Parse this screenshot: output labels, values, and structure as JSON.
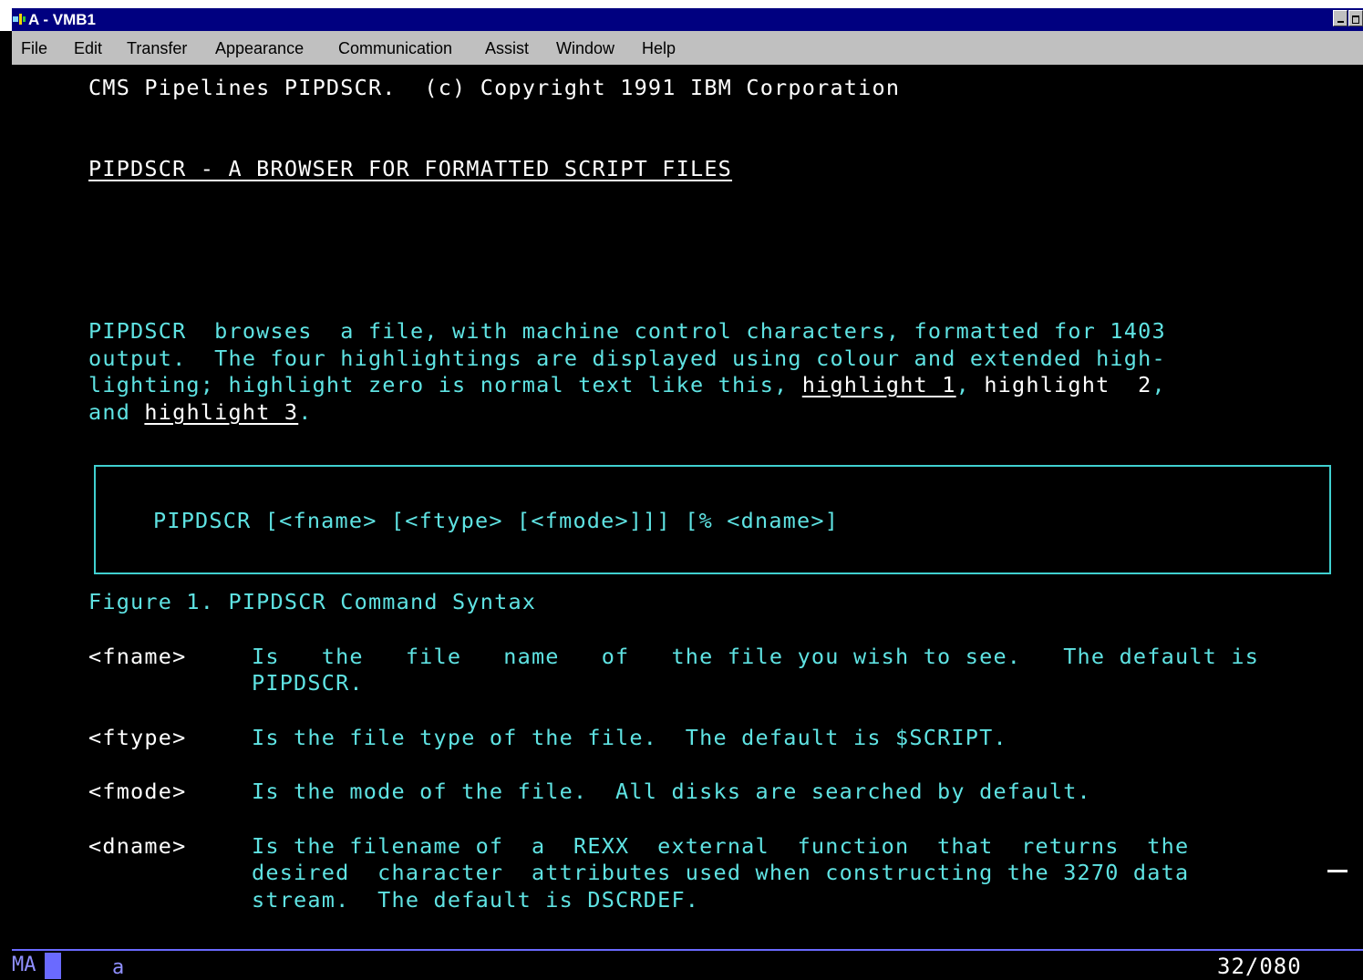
{
  "window": {
    "title": "A - VMB1"
  },
  "menu": {
    "file": "File",
    "edit": "Edit",
    "transfer": "Transfer",
    "appearance": "Appearance",
    "communication": "Communication",
    "assist": "Assist",
    "window": "Window",
    "help": "Help"
  },
  "screen": {
    "copyright": "CMS Pipelines PIPDSCR.  (c) Copyright 1991 IBM Corporation",
    "heading": "PIPDSCR - A BROWSER FOR FORMATTED SCRIPT FILES",
    "para": {
      "line1": "PIPDSCR  browses  a file, with machine control characters, formatted for 1403",
      "line2": "output.  The four highlightings are displayed using colour and extended high-",
      "line3_a": "lighting; highlight zero is normal text like this, ",
      "line3_h1": "highlight 1",
      "line3_b": ", ",
      "line3_h2": "highlight  2",
      "line3_c": ",",
      "line4_a": "and ",
      "line4_h3": "highlight 3",
      "line4_b": "."
    },
    "syntax": "PIPDSCR [<fname> [<ftype> [<fmode>]]] [% <dname>]",
    "figure_caption": "Figure 1. PIPDSCR Command Syntax",
    "params": {
      "fname_term": "<fname>",
      "fname_desc1": "Is   the   file   name   of   the file you wish to see.   The default is",
      "fname_desc2": "PIPDSCR.",
      "ftype_term": "<ftype>",
      "ftype_desc1": "Is the file type of the file.  The default is $SCRIPT.",
      "fmode_term": "<fmode>",
      "fmode_desc1": "Is the mode of the file.  All disks are searched by default.",
      "dname_term": "<dname>",
      "dname_desc1": "Is the filename of  a  REXX  external  function  that  returns  the",
      "dname_desc2": "desired  character  attributes used when constructing the 3270 data",
      "dname_desc3": "stream.  The default is DSCRDEF."
    }
  },
  "status": {
    "mode_indicator": "MA",
    "session_letter": "a",
    "cursor_position": "32/080"
  }
}
